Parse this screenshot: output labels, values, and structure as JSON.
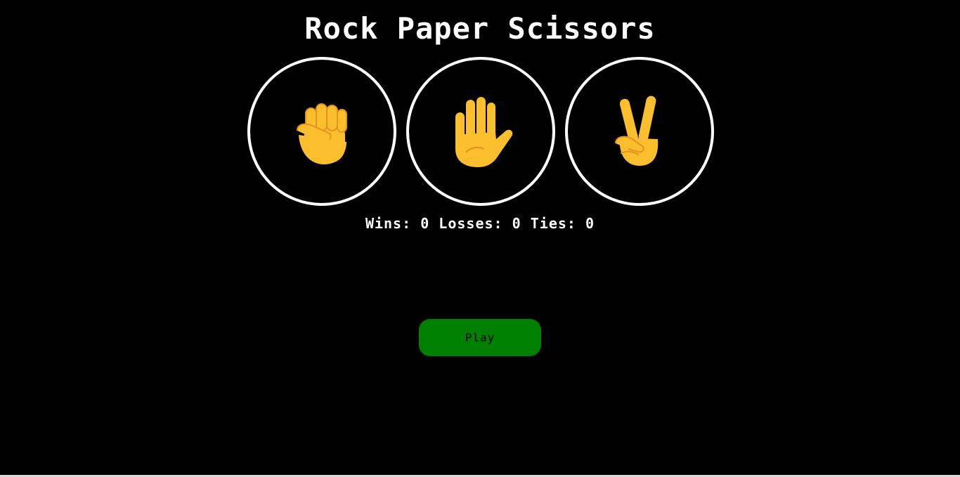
{
  "title": "Rock Paper Scissors",
  "choices": [
    {
      "id": "rock",
      "icon": "raised-fist-icon"
    },
    {
      "id": "paper",
      "icon": "raised-hand-icon"
    },
    {
      "id": "scissors",
      "icon": "victory-hand-icon"
    }
  ],
  "score": {
    "wins_label": "Wins:",
    "wins": "0",
    "losses_label": "Losses:",
    "losses": "0",
    "ties_label": "Ties:",
    "ties": "0"
  },
  "play_button": {
    "label": "Play"
  },
  "colors": {
    "background": "#000000",
    "text": "#ffffff",
    "circle_border": "#ffffff",
    "emoji_fill": "#fbbf2d",
    "emoji_line": "#e3941c",
    "play_button_bg": "#008000",
    "play_button_text": "#000000"
  }
}
